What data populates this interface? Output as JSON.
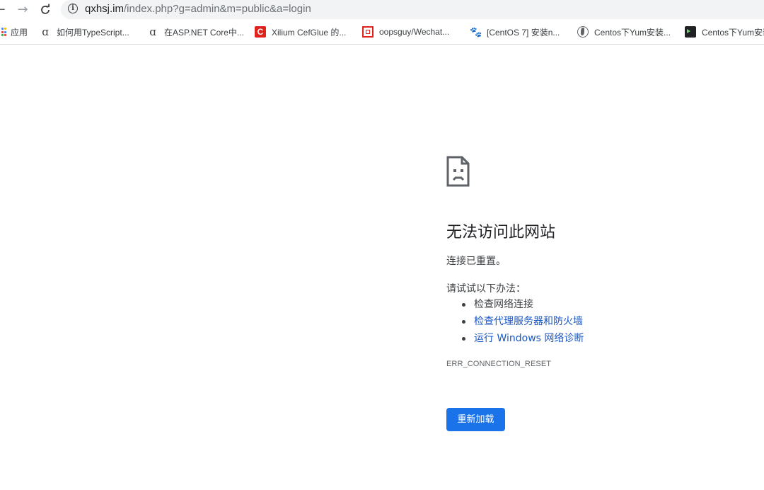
{
  "browser": {
    "url_host": "qxhsj.im",
    "url_path": "/index.php?g=admin&m=public&a=login"
  },
  "bookmarks": [
    {
      "label": "应用",
      "icon": "apps-grid-icon"
    },
    {
      "label": "如何用TypeScript...",
      "icon": "alpha-icon"
    },
    {
      "label": "在ASP.NET Core中...",
      "icon": "alpha-icon"
    },
    {
      "label": "Xilium CefGlue 的...",
      "icon": "cefglue-icon"
    },
    {
      "label": "oopsguy/Wechat...",
      "icon": "repo-icon"
    },
    {
      "label": "[CentOS 7] 安装n...",
      "icon": "paw-icon"
    },
    {
      "label": "Centos下Yum安装...",
      "icon": "globe-icon"
    },
    {
      "label": "Centos下Yum安装",
      "icon": "terminal-icon"
    }
  ],
  "error": {
    "title": "无法访问此网站",
    "description": "连接已重置。",
    "try_label": "请试试以下办法：",
    "suggestions": [
      "检查网络连接",
      "检查代理服务器和防火墙",
      "运行 Windows 网络诊断"
    ],
    "code": "ERR_CONNECTION_RESET",
    "reload_label": "重新加载"
  },
  "colors": {
    "button": "#1a73e8",
    "link": "#1a56c4",
    "omnibox": "#f1f3f4"
  }
}
